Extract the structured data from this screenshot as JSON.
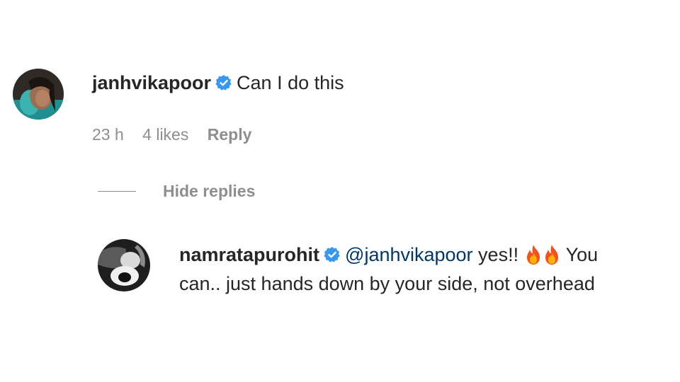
{
  "comment": {
    "username": "janhvikapoor",
    "text": "Can I do this",
    "time": "23 h",
    "likes": "4 likes",
    "reply_label": "Reply",
    "avatar_icon": "profile-photo",
    "verified_icon": "verified-badge-icon",
    "verified_color": "#3897f0"
  },
  "replies_toggle": {
    "label": "Hide replies"
  },
  "reply": {
    "username": "namratapurohit",
    "mention": "@janhvikapoor",
    "text_after_mention": " yes!! ",
    "emoji": [
      "fire-icon",
      "fire-icon"
    ],
    "text_tail": " You",
    "text_line2": "can.. just hands down by your side, not overhead",
    "avatar_icon": "profile-photo"
  },
  "colors": {
    "text": "#262626",
    "secondary": "#8e8e8e",
    "mention": "#00376b"
  }
}
